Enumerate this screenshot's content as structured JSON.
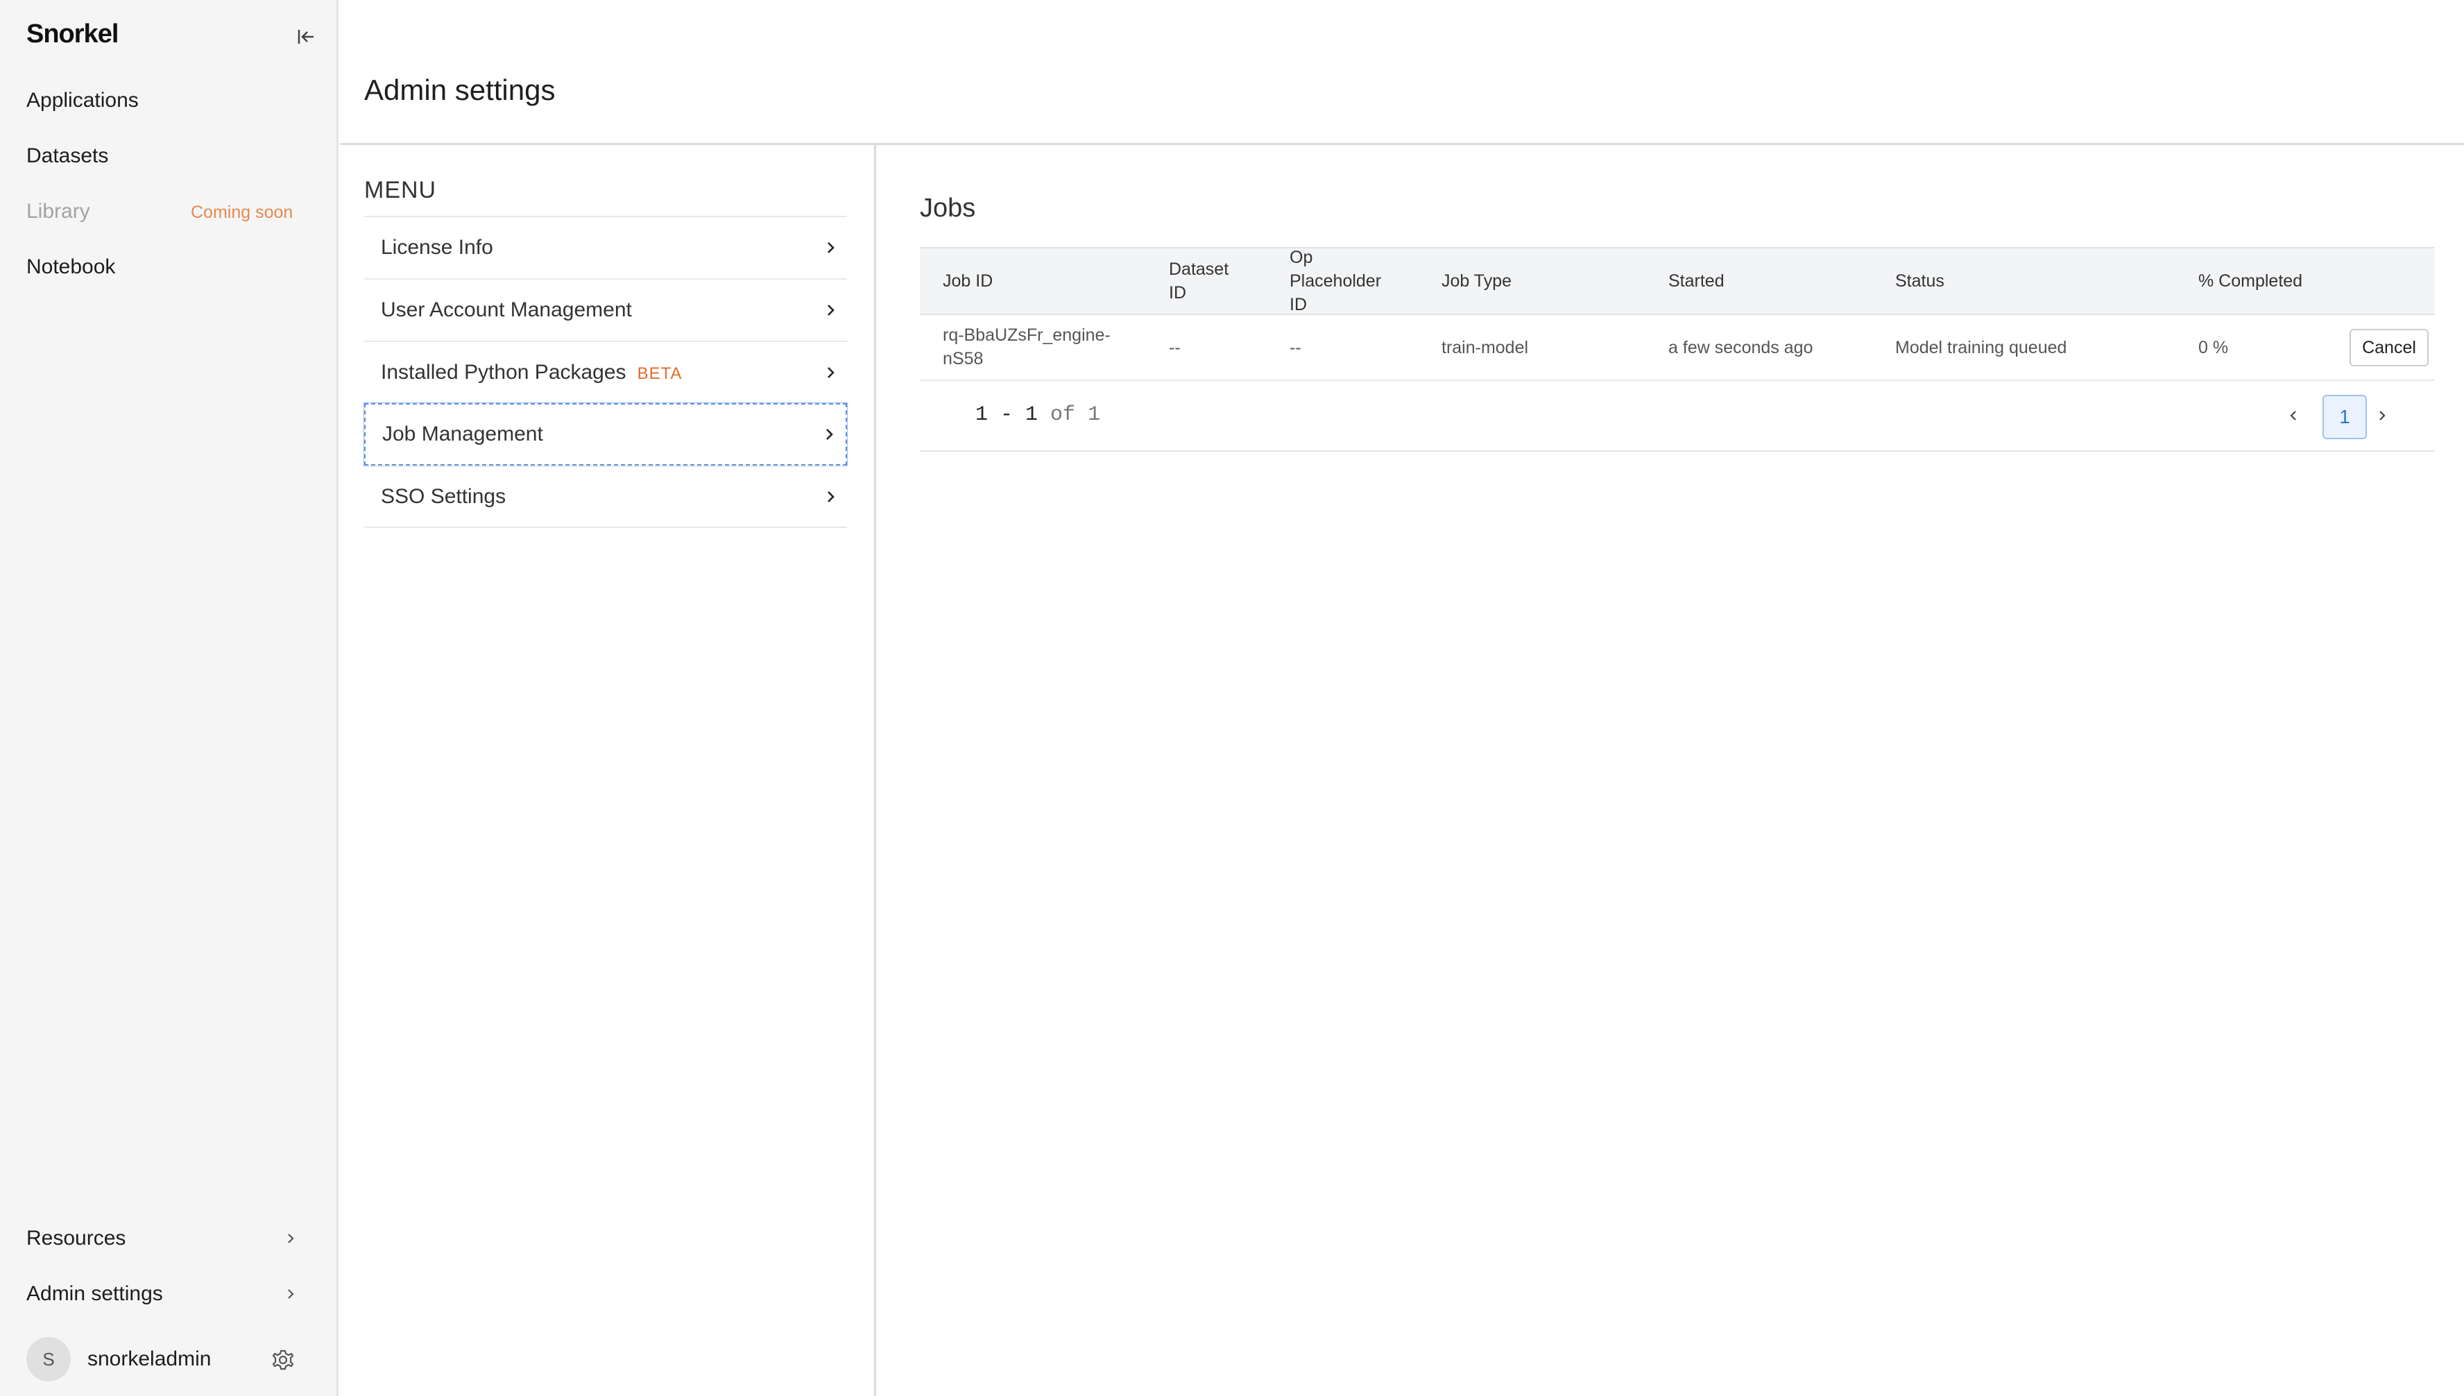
{
  "app": {
    "logo": "Snorkel"
  },
  "sidebar": {
    "nav": [
      {
        "label": "Applications"
      },
      {
        "label": "Datasets"
      },
      {
        "label": "Library",
        "badge": "Coming soon"
      },
      {
        "label": "Notebook"
      }
    ],
    "bottom": [
      {
        "label": "Resources"
      },
      {
        "label": "Admin settings"
      }
    ],
    "user": {
      "initial": "S",
      "name": "snorkeladmin"
    }
  },
  "header": {
    "title": "Admin settings"
  },
  "menu": {
    "heading": "MENU",
    "items": [
      {
        "label": "License Info"
      },
      {
        "label": "User Account Management"
      },
      {
        "label": "Installed Python Packages",
        "badge": "BETA"
      },
      {
        "label": "Job Management",
        "active": true
      },
      {
        "label": "SSO Settings"
      }
    ]
  },
  "jobs": {
    "title": "Jobs",
    "columns": [
      "Job ID",
      "Dataset ID",
      "Op Placeholder ID",
      "Job Type",
      "Started",
      "Status",
      "% Completed"
    ],
    "rows": [
      {
        "job_id_line1": "rq-BbaUZsFr_engine-",
        "job_id_line2": "nS58",
        "dataset_id": "--",
        "op_placeholder_id": "--",
        "job_type": "train-model",
        "started": "a few seconds ago",
        "status": "Model training queued",
        "completed": "0 %",
        "action": "Cancel"
      }
    ],
    "pagination": {
      "range": "1 - 1",
      "of_label": "of",
      "total": "1",
      "current_page": "1"
    }
  },
  "colors": {
    "accent": "#2f74d0",
    "beta": "#e46a2e",
    "coming_soon": "#e6894f",
    "sidebar_bg": "#f5f5f5"
  }
}
